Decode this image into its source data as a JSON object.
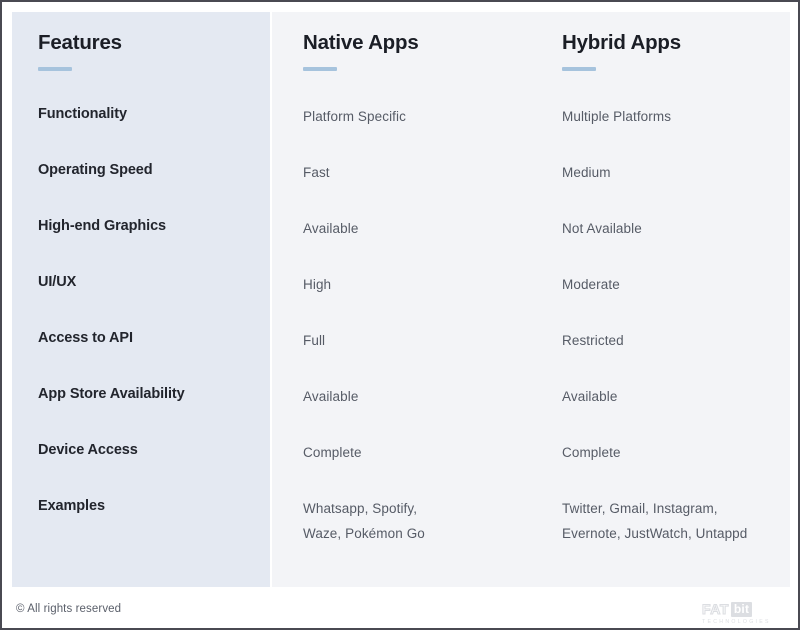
{
  "columns": {
    "features": {
      "title": "Features"
    },
    "native": {
      "title": "Native Apps"
    },
    "hybrid": {
      "title": "Hybrid Apps"
    }
  },
  "rows": [
    {
      "feature": "Functionality",
      "native": "Platform Specific",
      "hybrid": "Multiple Platforms"
    },
    {
      "feature": "Operating Speed",
      "native": "Fast",
      "hybrid": "Medium"
    },
    {
      "feature": "High-end Graphics",
      "native": "Available",
      "hybrid": "Not Available"
    },
    {
      "feature": "UI/UX",
      "native": "High",
      "hybrid": "Moderate"
    },
    {
      "feature": "Access to API",
      "native": "Full",
      "hybrid": "Restricted"
    },
    {
      "feature": "App Store Availability",
      "native": "Available",
      "hybrid": "Available"
    },
    {
      "feature": "Device Access",
      "native": "Complete",
      "hybrid": "Complete"
    },
    {
      "feature": "Examples",
      "native": "Whatsapp, Spotify, Waze, Pokémon Go",
      "hybrid": "Twitter, Gmail, Instagram, Evernote, JustWatch, Untappd"
    }
  ],
  "footer": {
    "copyright": "© All rights reserved",
    "logo_main": "FAT",
    "logo_badge": "bit",
    "logo_sub": "TECHNOLOGIES"
  },
  "colors": {
    "features_panel": "#e4e9f2",
    "value_panel": "#f3f4f7",
    "accent": "#a6c3dd",
    "heading": "#1b1e26",
    "value_text": "#565b66",
    "frame_border": "#4a4a52"
  }
}
